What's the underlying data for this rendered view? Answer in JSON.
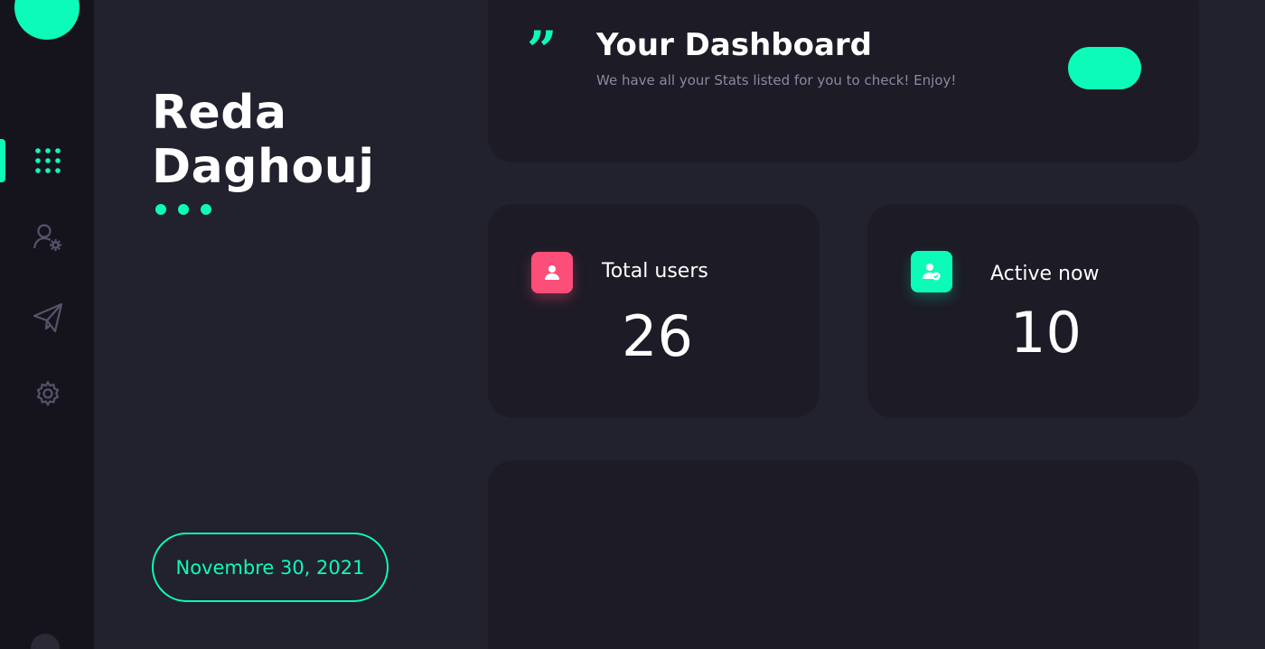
{
  "profile": {
    "first_name": "Reda",
    "last_name": "Daghouj",
    "date": "Novembre 30, 2021"
  },
  "header": {
    "title": "Your Dashboard",
    "subtitle": "We have all your Stats listed for you to check! Enjoy!",
    "quote_glyph": "”"
  },
  "stats": {
    "total_users": {
      "label": "Total users",
      "value": "26",
      "icon": "user-icon"
    },
    "active_now": {
      "label": "Active now",
      "value": "10",
      "icon": "user-check-icon"
    }
  },
  "sidebar": {
    "items": [
      {
        "icon": "grid-icon",
        "active": true
      },
      {
        "icon": "user-settings-icon",
        "active": false
      },
      {
        "icon": "send-icon",
        "active": false
      },
      {
        "icon": "gear-icon",
        "active": false
      }
    ]
  },
  "colors": {
    "accent": "#0dfbb9",
    "pink": "#fb4e79",
    "background": "#22212e",
    "card": "#1c1b26",
    "sidebar": "#15141d"
  }
}
